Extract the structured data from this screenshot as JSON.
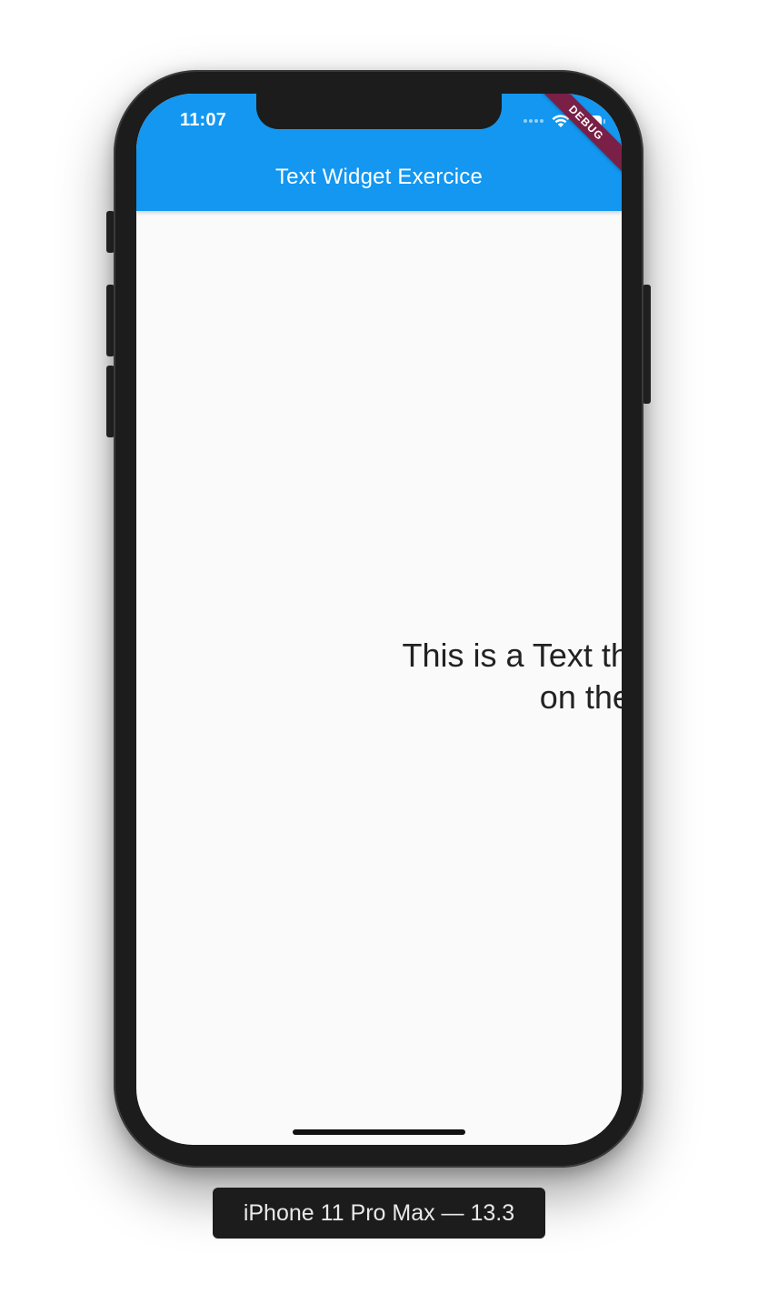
{
  "colors": {
    "appbar": "#1397f0",
    "debug_banner": "#7a1f46",
    "device_body": "#1c1c1c",
    "screen_background": "#fafafa"
  },
  "status_bar": {
    "time": "11:07",
    "icons": [
      "signal-icon",
      "wifi-icon",
      "battery-icon"
    ]
  },
  "app_bar": {
    "title": "Text Widget Exercice"
  },
  "debug_banner": {
    "label": "DEBUG"
  },
  "body": {
    "line1": "This is a Text that is align",
    "line2": "on the right and"
  },
  "device_label": "iPhone 11 Pro Max — 13.3"
}
